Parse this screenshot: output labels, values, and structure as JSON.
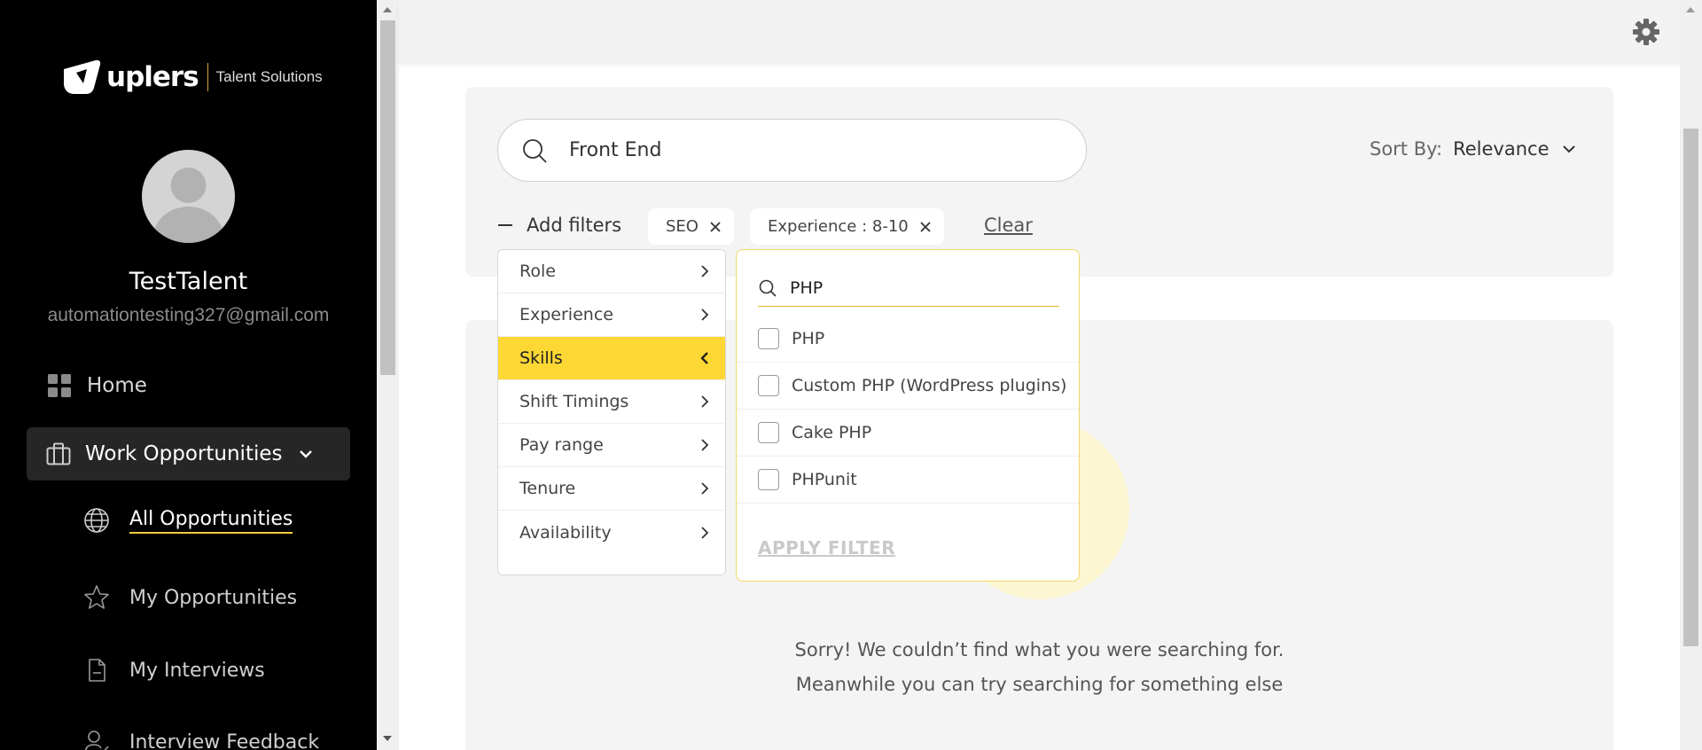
{
  "sidebar": {
    "logo_word": "uplers",
    "logo_sub": "Talent Solutions",
    "profile_name": "TestTalent",
    "profile_email": "automationtesting327@gmail.com",
    "nav": {
      "home": "Home",
      "work": "Work Opportunities",
      "sub": {
        "all": "All Opportunities",
        "mine": "My Opportunities",
        "interviews": "My Interviews",
        "feedback": "Interview Feedback"
      }
    }
  },
  "header": {
    "settings_icon": "gear-icon"
  },
  "search": {
    "value": "Front End"
  },
  "sort": {
    "label": "Sort By:",
    "value": "Relevance"
  },
  "filters": {
    "add_label": "Add filters",
    "chips": [
      {
        "label": "SEO"
      },
      {
        "label": "Experience : 8-10"
      }
    ],
    "clear_label": "Clear",
    "categories": [
      {
        "label": "Role"
      },
      {
        "label": "Experience"
      },
      {
        "label": "Skills"
      },
      {
        "label": "Shift Timings"
      },
      {
        "label": "Pay range"
      },
      {
        "label": "Tenure"
      },
      {
        "label": "Availability"
      }
    ],
    "active_category": "Skills",
    "skills": {
      "search_value": "PHP",
      "options": [
        {
          "label": "PHP",
          "checked": false
        },
        {
          "label": "Custom PHP (WordPress plugins)",
          "checked": false
        },
        {
          "label": "Cake PHP",
          "checked": false
        },
        {
          "label": "PHPunit",
          "checked": false
        }
      ],
      "apply_label": "APPLY FILTER"
    }
  },
  "empty_state": {
    "line1": "Sorry! We couldn’t find what you were searching for.",
    "line2": "Meanwhile you can try searching for something else"
  },
  "colors": {
    "accent": "#fdd835",
    "sidebar_bg": "#000000"
  }
}
